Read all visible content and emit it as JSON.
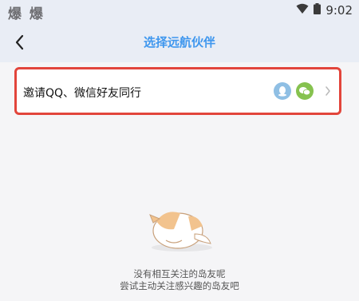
{
  "status_bar": {
    "left_text": "爆 爆",
    "time": "9:02",
    "icons": [
      "wifi-icon",
      "battery-icon"
    ]
  },
  "header": {
    "title": "选择远航伙伴",
    "back_icon": "chevron-left-icon"
  },
  "invite_row": {
    "label": "邀请QQ、微信好友同行",
    "icons": [
      "qq-icon",
      "wechat-icon",
      "chevron-right-icon"
    ],
    "highlight_color": "#e2453b"
  },
  "empty_state": {
    "illustration": "sleeping-cat-illustration",
    "line1": "没有相互关注的岛友呢",
    "line2": "尝试主动关注感兴趣的岛友吧"
  },
  "colors": {
    "accent": "#3f97ee",
    "qq": "#8fbfe4",
    "wechat": "#86c24f",
    "header_bg": "#e9edf5",
    "page_bg": "#f5f5f7"
  }
}
